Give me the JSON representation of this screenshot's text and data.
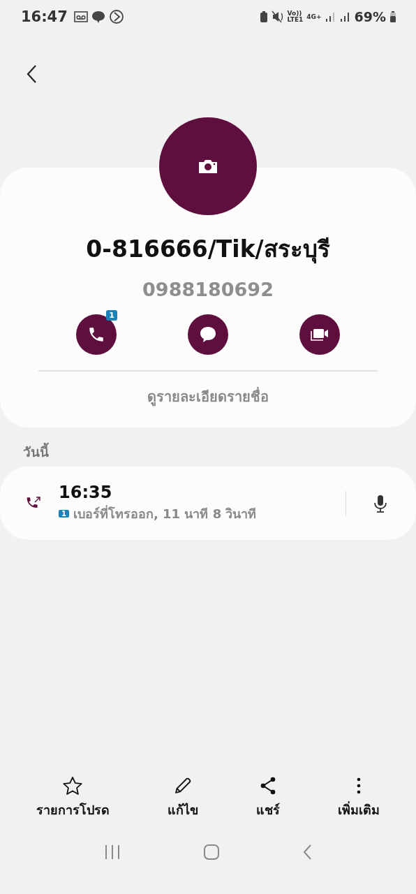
{
  "status_bar": {
    "time": "16:47",
    "volte": "Vo))",
    "lte": "LTE1",
    "network": "4G+",
    "battery": "69%"
  },
  "contact": {
    "name": "0-816666/Tik/สระบุรี",
    "number": "0988180692"
  },
  "actions": [
    {
      "kind": "call",
      "badge": "1"
    },
    {
      "kind": "message"
    },
    {
      "kind": "video"
    }
  ],
  "details_link": "ดูรายละเอียดรายชื่อ",
  "section": "วันนี้",
  "call_log": [
    {
      "time": "16:35",
      "sim": "1",
      "description": "เบอร์ที่โทรออก, 11 นาที 8 วินาที"
    }
  ],
  "bottom_actions": [
    {
      "kind": "favorite",
      "label": "รายการโปรด"
    },
    {
      "kind": "edit",
      "label": "แก้ไข"
    },
    {
      "kind": "share",
      "label": "แชร์"
    },
    {
      "kind": "more",
      "label": "เพิ่มเติม"
    }
  ]
}
